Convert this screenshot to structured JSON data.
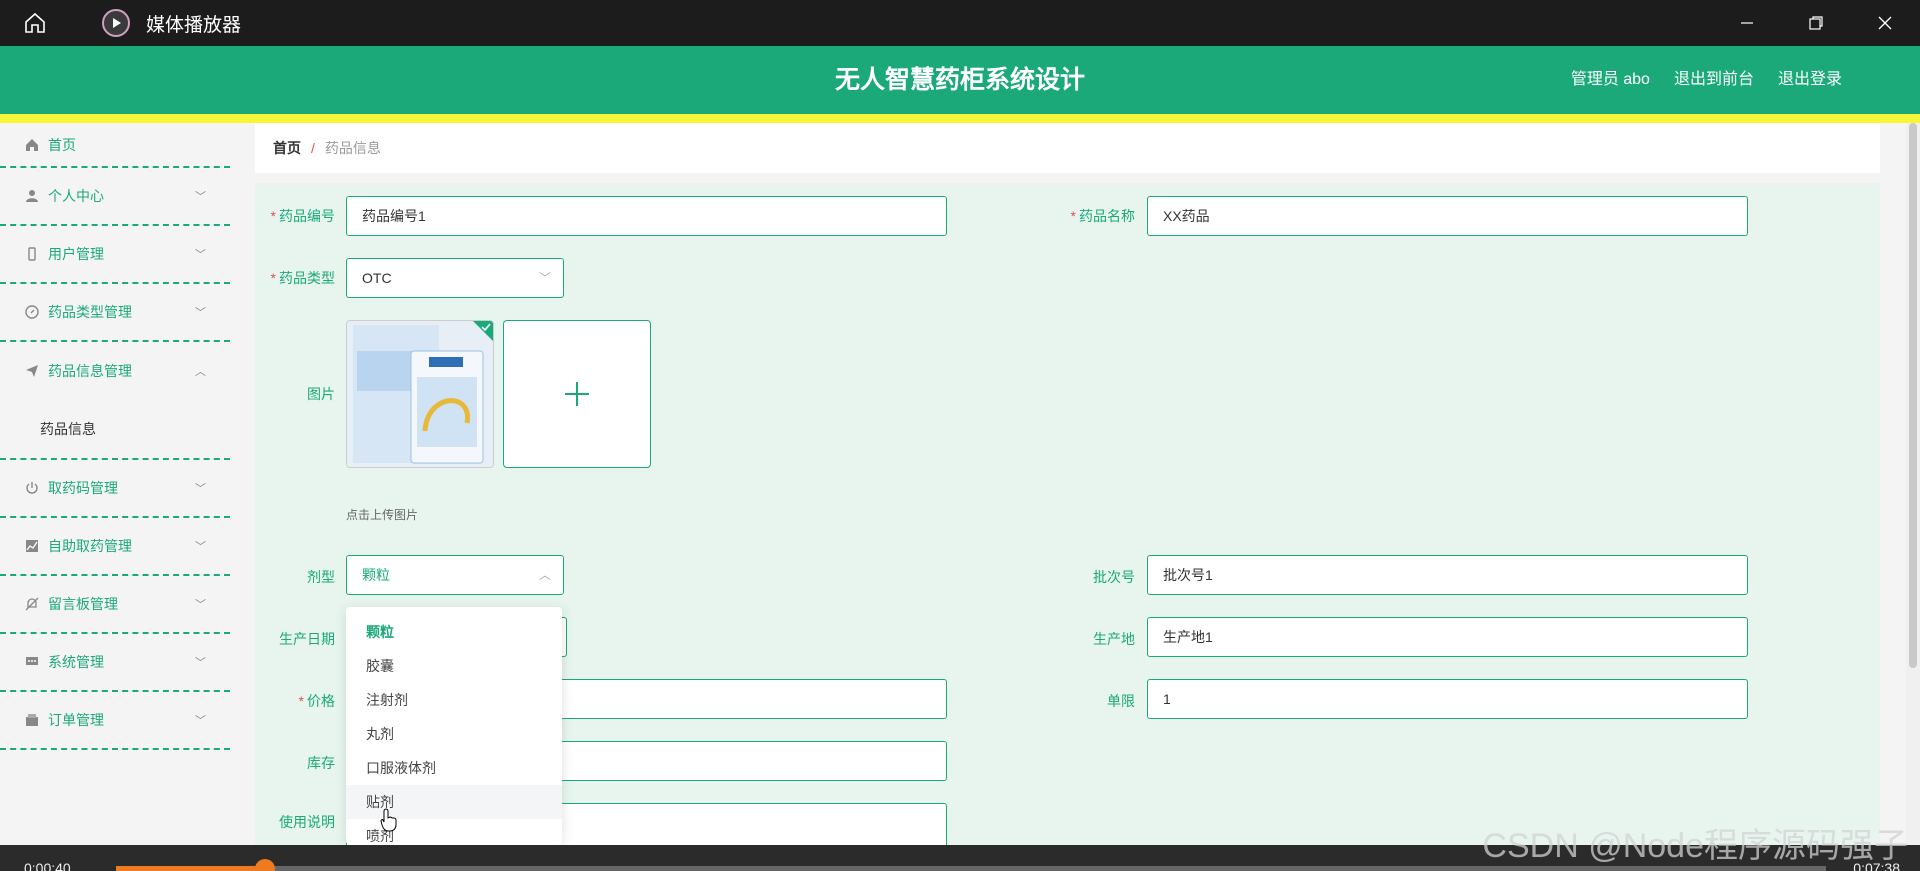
{
  "player": {
    "app_title": "媒体播放器",
    "time_elapsed": "0:00:40",
    "time_total": "0:07:38",
    "progress_fraction": 0.087,
    "accent": "#f07a20"
  },
  "header": {
    "title": "无人智慧药柜系统设计",
    "admin_label": "管理员 abo",
    "to_front": "退出到前台",
    "logout": "退出登录",
    "bg_color": "#1ba97a",
    "stripe_color": "#f5f53a"
  },
  "sidebar": {
    "items": [
      {
        "label": "首页",
        "icon": "home-icon"
      },
      {
        "label": "个人中心",
        "icon": "user-icon"
      },
      {
        "label": "用户管理",
        "icon": "phone-icon"
      },
      {
        "label": "药品类型管理",
        "icon": "compass-icon"
      },
      {
        "label": "药品信息管理",
        "icon": "send-icon",
        "expanded": true
      },
      {
        "label": "取药码管理",
        "icon": "power-icon"
      },
      {
        "label": "自助取药管理",
        "icon": "chart-icon"
      },
      {
        "label": "留言板管理",
        "icon": "bell-off-icon"
      },
      {
        "label": "系统管理",
        "icon": "chat-icon"
      },
      {
        "label": "订单管理",
        "icon": "wallet-icon"
      }
    ],
    "submenu": {
      "label": "药品信息"
    }
  },
  "breadcrumb": {
    "home": "首页",
    "separator": "/",
    "current": "药品信息"
  },
  "form": {
    "code": {
      "label": "药品编号",
      "value": "药品编号1"
    },
    "name": {
      "label": "药品名称",
      "value": "XX药品"
    },
    "type": {
      "label": "药品类型",
      "value": "OTC"
    },
    "image": {
      "label": "图片",
      "hint": "点击上传图片"
    },
    "dosage": {
      "label": "剂型",
      "value": "颗粒"
    },
    "batch": {
      "label": "批次号",
      "value": "批次号1"
    },
    "prod_date": {
      "label": "生产日期"
    },
    "origin": {
      "label": "生产地",
      "value": "生产地1"
    },
    "price": {
      "label": "价格"
    },
    "limit": {
      "label": "单限",
      "value": "1"
    },
    "stock": {
      "label": "库存"
    },
    "instructions": {
      "label": "使用说明"
    }
  },
  "dosage_options": [
    "颗粒",
    "胶囊",
    "注射剂",
    "丸剂",
    "口服液体剂",
    "贴剂",
    "喷剂"
  ],
  "watermark": "CSDN @Node程序源码强子"
}
